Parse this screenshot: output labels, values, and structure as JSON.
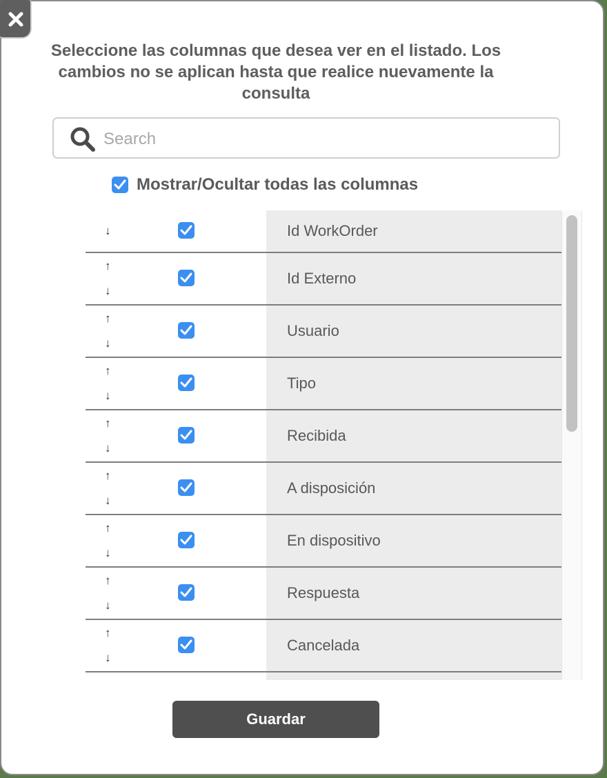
{
  "dialog": {
    "title_lines": [
      "Seleccione las columnas que desea ver en el listado. Los",
      "cambios no se aplican hasta que realice nuevamente la",
      "consulta"
    ]
  },
  "search": {
    "placeholder": "Search",
    "value": ""
  },
  "toggle_all": {
    "label": "Mostrar/Ocultar todas las columnas",
    "checked": true
  },
  "columns": [
    {
      "name": "Id WorkOrder",
      "checked": true
    },
    {
      "name": "Id Externo",
      "checked": true
    },
    {
      "name": "Usuario",
      "checked": true
    },
    {
      "name": "Tipo",
      "checked": true
    },
    {
      "name": "Recibida",
      "checked": true
    },
    {
      "name": "A disposición",
      "checked": true
    },
    {
      "name": "En dispositivo",
      "checked": true
    },
    {
      "name": "Respuesta",
      "checked": true
    },
    {
      "name": "Cancelada",
      "checked": true
    }
  ],
  "arrows": {
    "up": "↑",
    "down": "↓"
  },
  "actions": {
    "save_label": "Guardar"
  },
  "colors": {
    "checkbox": "#3b8ff0",
    "button": "#4f4f4f",
    "row_name_bg": "#ececec"
  }
}
